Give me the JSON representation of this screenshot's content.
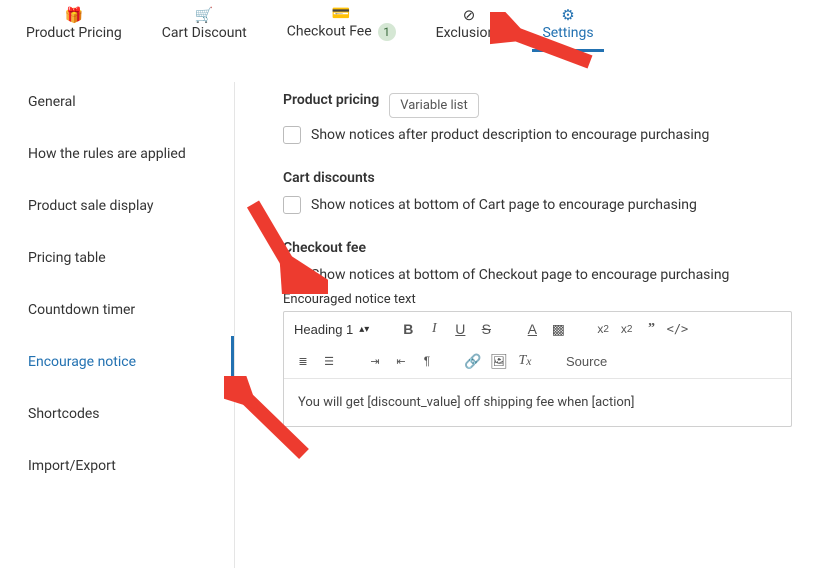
{
  "tabs": [
    {
      "label": "Product Pricing",
      "icon": "🎁"
    },
    {
      "label": "Cart Discount",
      "icon": "🛒"
    },
    {
      "label": "Checkout Fee",
      "icon": "💳",
      "badge": "1"
    },
    {
      "label": "Exclusions",
      "icon": "⊘"
    },
    {
      "label": "Settings",
      "icon": "⚙"
    }
  ],
  "sidebar": [
    {
      "label": "General"
    },
    {
      "label": "How the rules are applied"
    },
    {
      "label": "Product sale display"
    },
    {
      "label": "Pricing table"
    },
    {
      "label": "Countdown timer"
    },
    {
      "label": "Encourage notice"
    },
    {
      "label": "Shortcodes"
    },
    {
      "label": "Import/Export"
    }
  ],
  "main": {
    "section1": {
      "title": "Product pricing",
      "button": "Variable list",
      "checkbox_label": "Show notices after product description to encourage purchasing"
    },
    "section2": {
      "title": "Cart discounts",
      "checkbox_label": "Show notices at bottom of Cart page to encourage purchasing"
    },
    "section3": {
      "title": "Checkout fee",
      "checkbox_label": "Show notices at bottom of Checkout page to encourage purchasing",
      "subtitle": "Encouraged notice text",
      "heading_select": "Heading 1",
      "source_label": "Source",
      "editor_text": "You will get [discount_value] off shipping fee when [action]"
    }
  }
}
